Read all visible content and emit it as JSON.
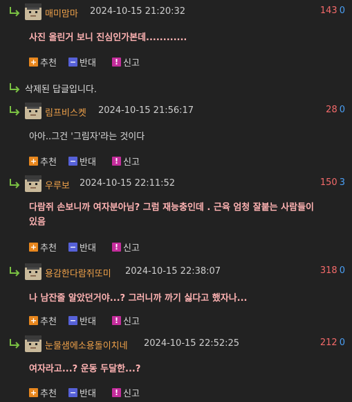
{
  "actions": {
    "recommend": "추천",
    "oppose": "반대",
    "report": "신고"
  },
  "deleted_reply": "삭제된 답글입니다.",
  "comments": [
    {
      "nick": "매미맘마",
      "date": "2024-10-15 21:20:32",
      "up": "143",
      "down": "0",
      "text": "사진 올린거 보니 진심인가본데............",
      "style": "pink"
    },
    {
      "nick": "림프비스켓",
      "date": "2024-10-15 21:56:17",
      "up": "28",
      "down": "0",
      "text": "아아..그건 '그림자'라는 것이다",
      "style": "plain"
    },
    {
      "nick": "우루보",
      "date": "2024-10-15 22:11:52",
      "up": "150",
      "down": "3",
      "text_line1": "다람쥐 손보니까 여자분아님? 그럼 재능충인데 . 근육 엄청 잘붙는 사람들이",
      "text_line2": "있음",
      "style": "pink"
    },
    {
      "nick": "용감한다람쥐또미",
      "date": "2024-10-15 22:38:07",
      "up": "318",
      "down": "0",
      "text": "나 남잔줄 알았던거야...? 그러니까 까기 싫다고 했자나...",
      "style": "pink"
    },
    {
      "nick": "눈물샘에소용돌이치네",
      "date": "2024-10-15 22:52:25",
      "up": "212",
      "down": "0",
      "text": "여자라고...? 운동 두달한...?",
      "style": "pink"
    }
  ]
}
